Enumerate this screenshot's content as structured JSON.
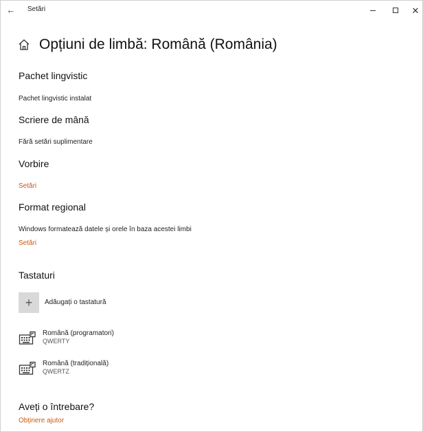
{
  "window": {
    "back_glyph": "←",
    "app_title": "Setări",
    "minimize_icon": "minimize-icon",
    "maximize_icon": "maximize-icon",
    "close_glyph": "✕"
  },
  "header": {
    "title": "Opțiuni de limbă: Română (România)",
    "home_icon": "home-icon"
  },
  "sections": {
    "language_pack": {
      "title": "Pachet lingvistic",
      "status": "Pachet lingvistic instalat"
    },
    "handwriting": {
      "title": "Scriere de mână",
      "status": "Fără setări suplimentare"
    },
    "speech": {
      "title": "Vorbire",
      "link": "Setări"
    },
    "regional_format": {
      "title": "Format regional",
      "description": "Windows formatează datele și orele în baza acestei limbi",
      "link": "Setări"
    },
    "keyboards": {
      "title": "Tastaturi",
      "add_label": "Adăugați o tastatură",
      "add_glyph": "+",
      "items": [
        {
          "name": "Română (programatori)",
          "layout": "QWERTY",
          "icon": "keyboard-icon"
        },
        {
          "name": "Română (tradițională)",
          "layout": "QWERTZ",
          "icon": "keyboard-icon"
        }
      ]
    },
    "help": {
      "title": "Aveți o întrebare?",
      "link": "Obținere ajutor"
    }
  },
  "colors": {
    "accent_link": "#c75b12",
    "add_tile": "#d9d9d9"
  }
}
